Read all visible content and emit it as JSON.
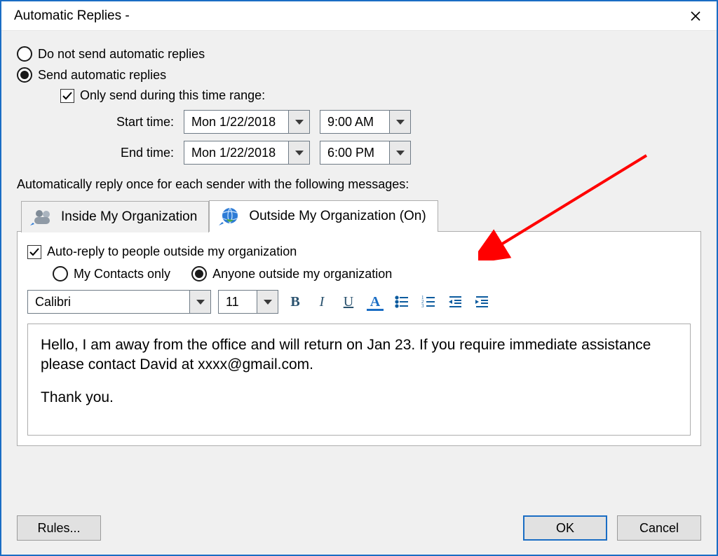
{
  "window": {
    "title": "Automatic Replies -"
  },
  "options": {
    "do_not_send": "Do not send automatic replies",
    "send": "Send automatic replies",
    "only_during": "Only send during this time range:"
  },
  "time": {
    "start_label": "Start time:",
    "end_label": "End time:",
    "start_date": "Mon 1/22/2018",
    "start_time": "9:00 AM",
    "end_date": "Mon 1/22/2018",
    "end_time": "6:00 PM"
  },
  "section_label": "Automatically reply once for each sender with the following messages:",
  "tabs": {
    "inside": "Inside My Organization",
    "outside": "Outside My Organization (On)"
  },
  "outside": {
    "auto_reply": "Auto-reply to people outside my organization",
    "my_contacts": "My Contacts only",
    "anyone": "Anyone outside my organization"
  },
  "format": {
    "font": "Calibri",
    "size": "11"
  },
  "message": {
    "p1": "Hello, I am away from the office and will return on Jan 23. If you require immediate assistance please contact David at xxxx@gmail.com.",
    "p2": "Thank you."
  },
  "buttons": {
    "rules": "Rules...",
    "ok": "OK",
    "cancel": "Cancel"
  }
}
